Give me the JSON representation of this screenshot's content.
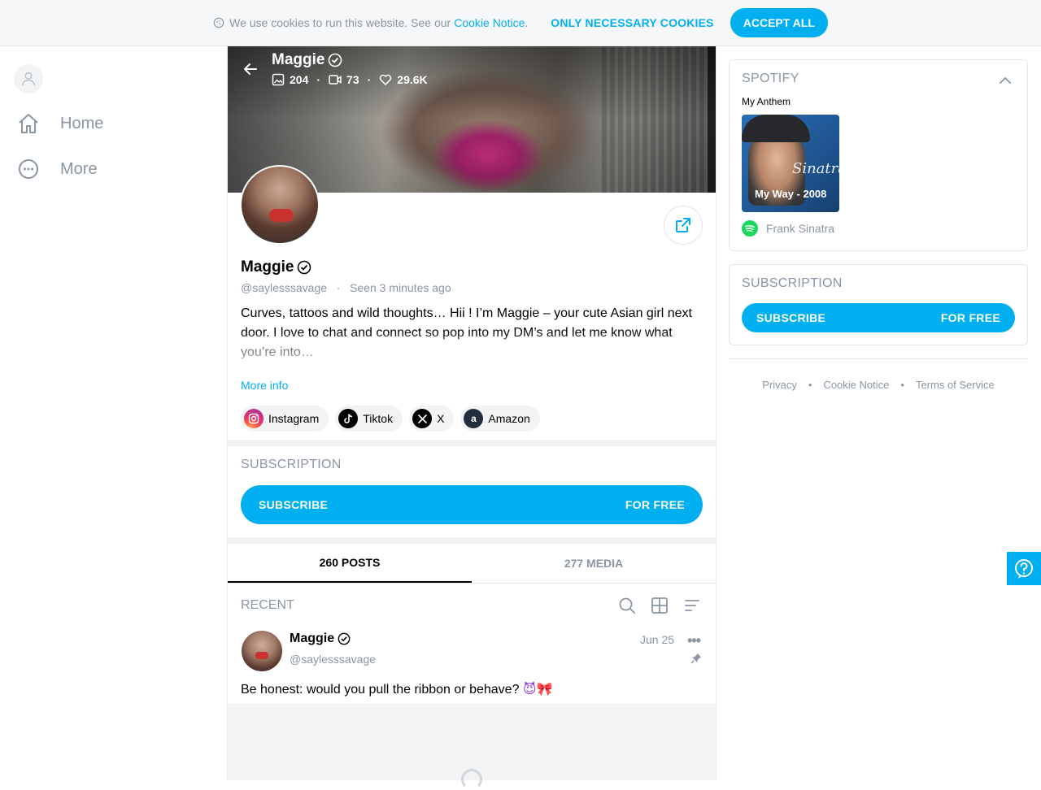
{
  "cookie_bar": {
    "message": "We use cookies to run this website. See our",
    "link": "Cookie Notice",
    "link_suffix": ".",
    "necessary_label": "ONLY NECESSARY COOKIES",
    "accept_label": "ACCEPT ALL"
  },
  "nav": {
    "items": [
      {
        "label": "Home",
        "icon": "home-icon"
      },
      {
        "label": "More",
        "icon": "more-icon"
      }
    ]
  },
  "cover": {
    "name": "Maggie ",
    "stats": {
      "photos": "204",
      "videos": "73",
      "likes": "29.6K"
    }
  },
  "profile": {
    "name": "Maggie ",
    "handle": "@saylesssavage",
    "seen_label": "Seen",
    "seen_time": "3 minutes ago",
    "bio": "Curves, tattoos and wild thoughts… Hii ! I’m Maggie – your cute Asian girl next door. I love to chat and connect so pop into my DM’s and let me know what you’re into…",
    "more_info": "More info",
    "socials": [
      {
        "label": "Instagram",
        "color": "#e1306c"
      },
      {
        "label": "Tiktok",
        "color": "#000000"
      },
      {
        "label": "X",
        "color": "#000000"
      },
      {
        "label": "Amazon",
        "color": "#232f3e"
      }
    ]
  },
  "subscription": {
    "title": "SUBSCRIPTION",
    "button_label": "SUBSCRIBE",
    "button_price": "FOR FREE"
  },
  "tabs": [
    {
      "label": "260 POSTS",
      "active": true
    },
    {
      "label": "277 MEDIA",
      "active": false
    }
  ],
  "feed": {
    "title": "RECENT",
    "post": {
      "name": "Maggie ",
      "handle": "@saylesssavage",
      "date": "Jun 25",
      "more": "•••",
      "text": "Be honest: would you pull the ribbon or behave?",
      "emoji1": "😈",
      "emoji2": "🎀"
    }
  },
  "spotify": {
    "title": "SPOTIFY",
    "anthem_label": "My Anthem",
    "track": "My Way - 2008",
    "signature": "Sinatra",
    "artist": "Frank Sinatra"
  },
  "right_subscription": {
    "title": "SUBSCRIPTION",
    "button_label": "SUBSCRIBE",
    "button_price": "FOR FREE"
  },
  "footer": {
    "links": [
      "Privacy",
      "Cookie Notice",
      "Terms of Service"
    ],
    "separator": "•"
  },
  "colors": {
    "accent": "#00aff0",
    "muted": "#8a96a3",
    "spotify": "#1ed760"
  }
}
